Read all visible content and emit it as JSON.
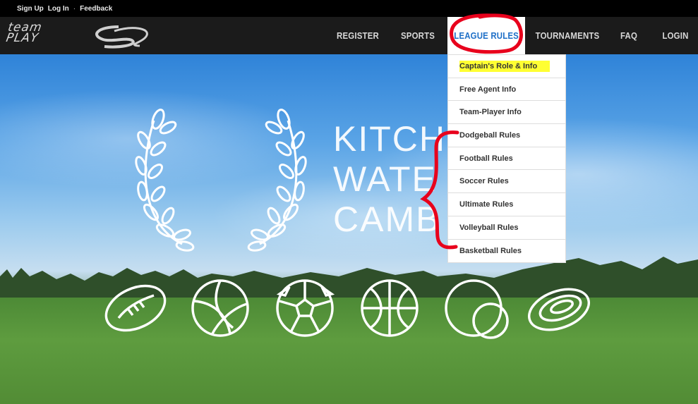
{
  "topbar": {
    "sign_up": "Sign Up",
    "log_in": "Log In",
    "separator": "·",
    "feedback": "Feedback"
  },
  "logo": {
    "line1": "team",
    "line2": "PLAY"
  },
  "nav": [
    {
      "label": "REGISTER"
    },
    {
      "label": "SPORTS"
    },
    {
      "label": "LEAGUE RULES",
      "active": true
    },
    {
      "label": "TOURNAMENTS"
    },
    {
      "label": "FAQ"
    },
    {
      "label": "LOGIN"
    }
  ],
  "dropdown": {
    "items": [
      {
        "label": "Captain's Role & Info",
        "highlighted": true
      },
      {
        "label": "Free Agent Info"
      },
      {
        "label": "Team-Player Info"
      },
      {
        "label": "Dodgeball Rules"
      },
      {
        "label": "Football Rules"
      },
      {
        "label": "Soccer Rules"
      },
      {
        "label": "Ultimate Rules"
      },
      {
        "label": "Volleyball Rules"
      },
      {
        "label": "Basketball Rules"
      }
    ]
  },
  "hero": {
    "line1": "KITCH",
    "line2": "WATE",
    "line3": "CAMB"
  },
  "sports_icons": [
    "football-icon",
    "volleyball-icon",
    "soccer-ball-icon",
    "basketball-icon",
    "dodgeball-icon",
    "frisbee-icon"
  ],
  "colors": {
    "active_nav_text": "#1e6fc7",
    "highlight": "#ffff33",
    "annotation": "#e8001c",
    "navbar": "#1b1b1b"
  }
}
